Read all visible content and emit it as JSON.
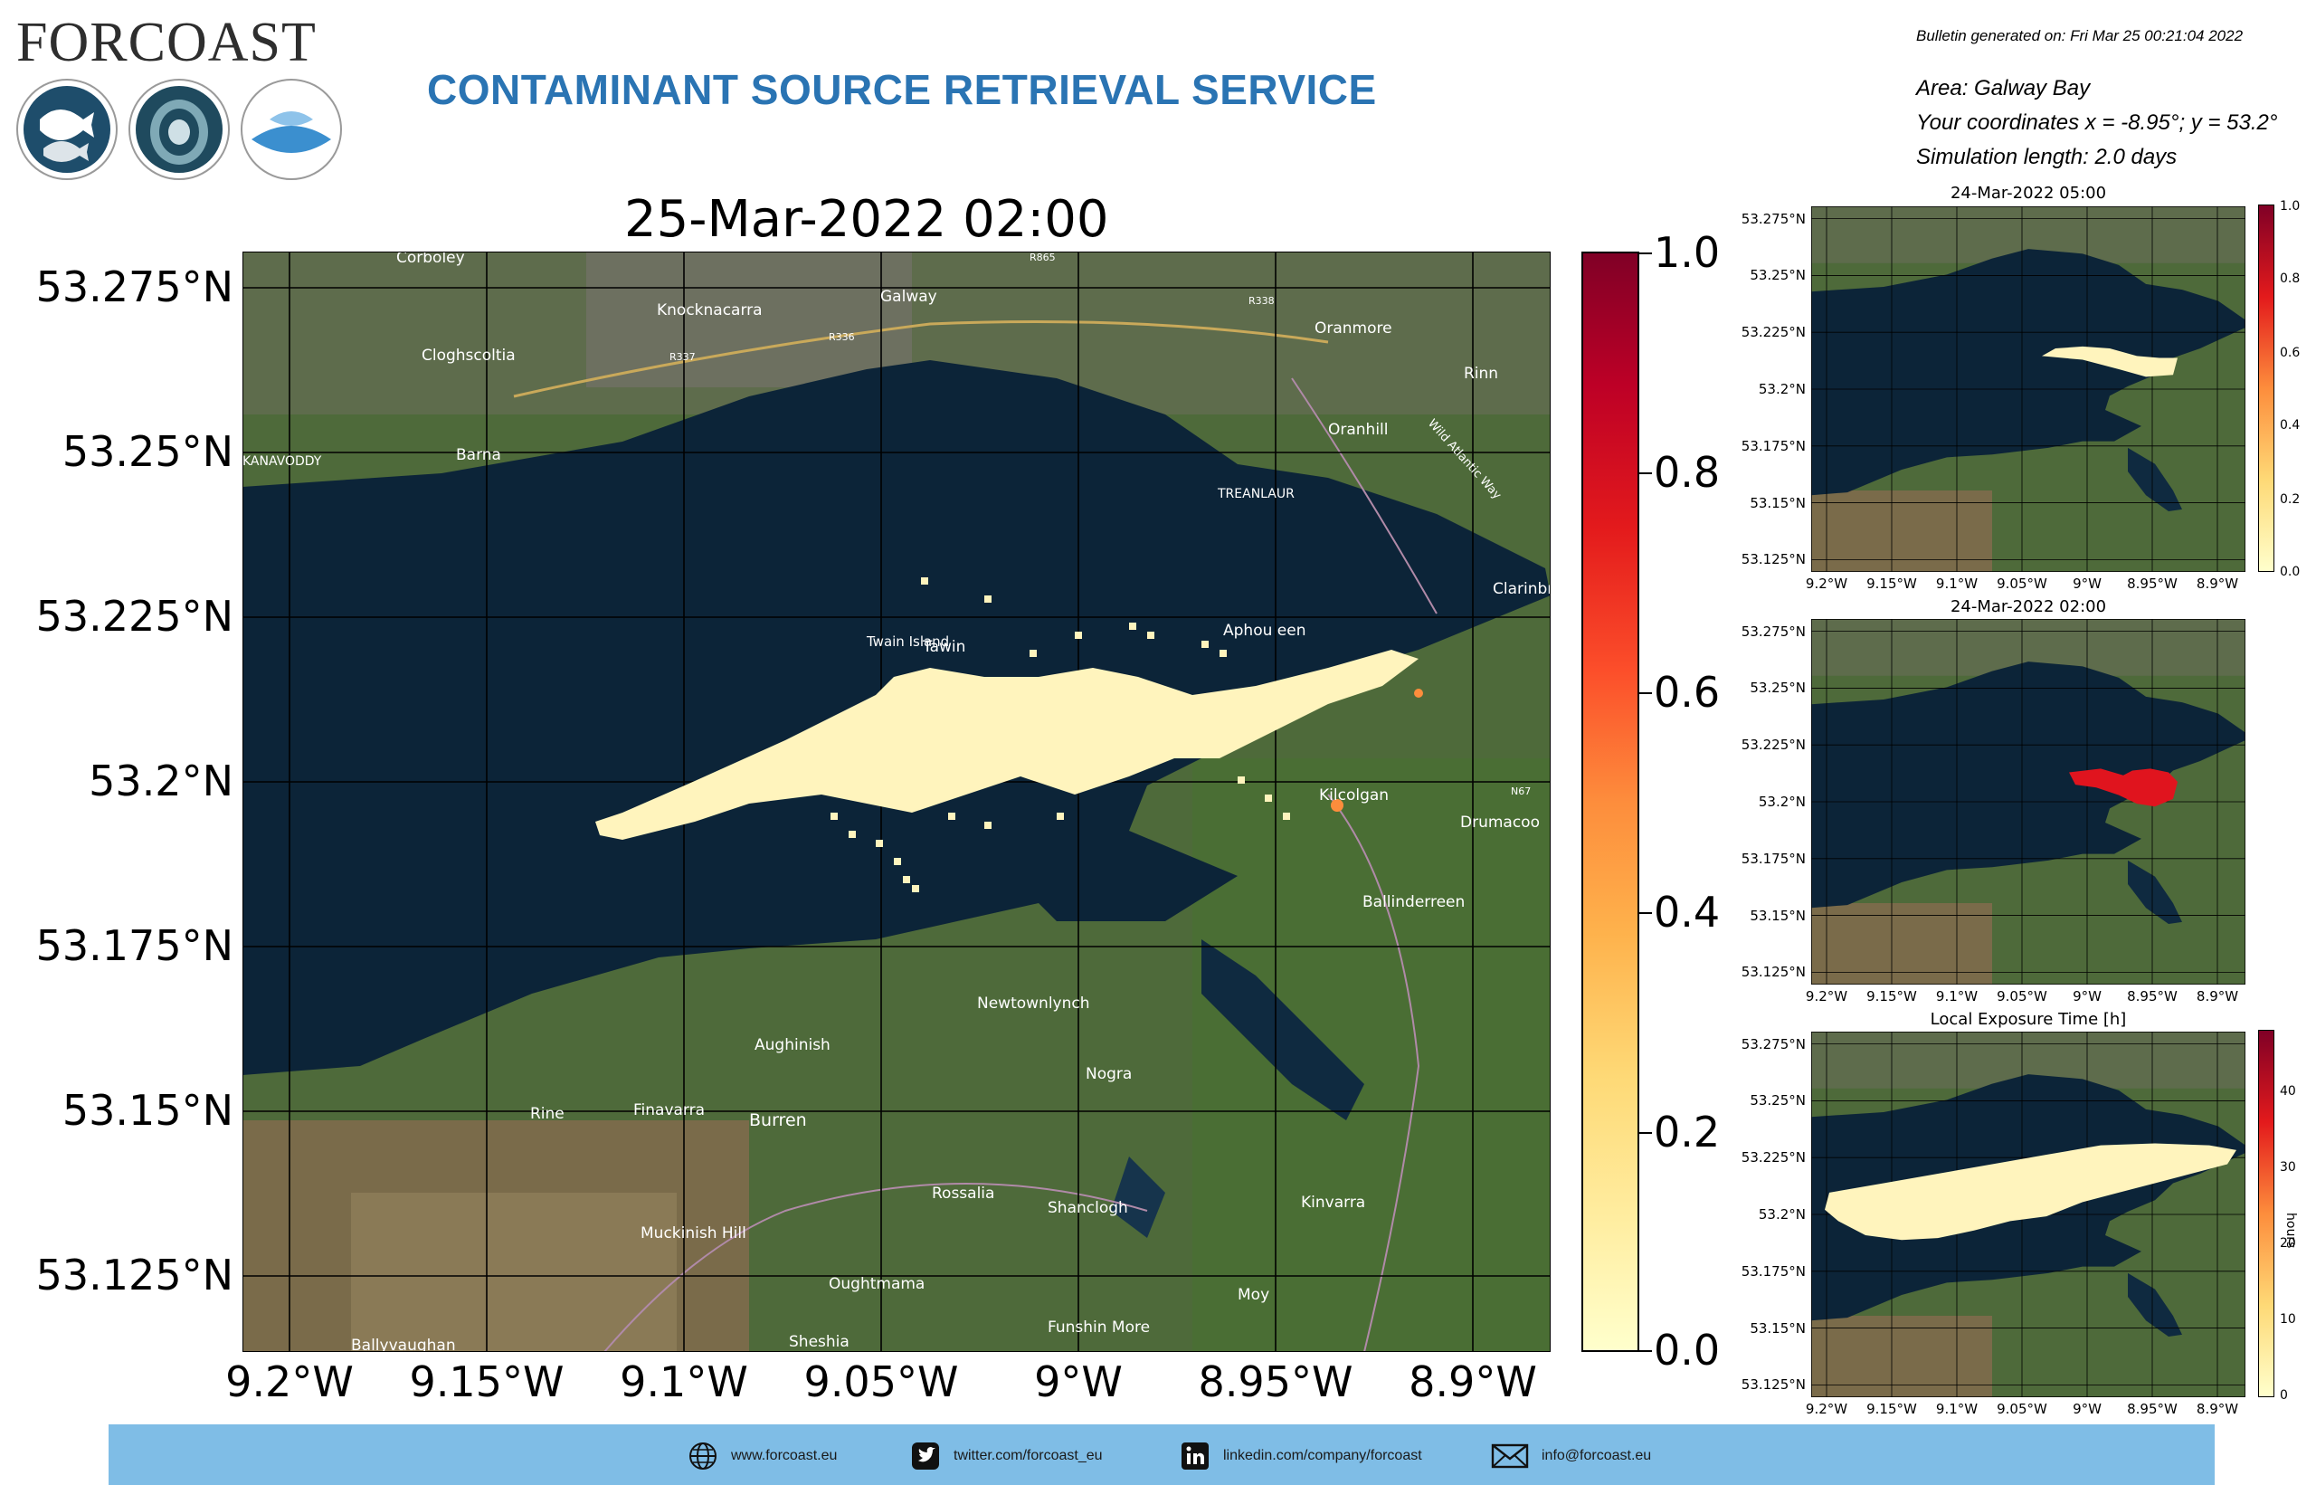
{
  "header": {
    "logo_text": "FORCOAST",
    "service_title": "CONTAMINANT SOURCE RETRIEVAL SERVICE",
    "bulletin": "Bulletin generated on: Fri Mar 25 00:21:04 2022",
    "area": "Area: Galway Bay",
    "coordinates": "Your coordinates x = -8.95°; y = 53.2°",
    "simulation": "Simulation length: 2.0 days",
    "logo_icons": [
      "fish-badge-icon",
      "oyster-badge-icon",
      "mussel-badge-icon"
    ]
  },
  "main_map": {
    "title": "25-Mar-2022 02:00",
    "lat_ticks": [
      "53.275°N",
      "53.25°N",
      "53.225°N",
      "53.2°N",
      "53.175°N",
      "53.15°N",
      "53.125°N"
    ],
    "lon_ticks": [
      "9.2°W",
      "9.15°W",
      "9.1°W",
      "9.05°W",
      "9°W",
      "8.95°W",
      "8.9°W"
    ],
    "colorbar_ticks": [
      "1.0",
      "0.8",
      "0.6",
      "0.4",
      "0.2",
      "0.0"
    ],
    "place_names": [
      "Corboley",
      "Galway",
      "Knocknacarra",
      "Cloghscoltia",
      "Oranmore",
      "Rinn",
      "Oranhill",
      "Barna",
      "KANAVODDY",
      "TREANLAUR",
      "Clarinbridge",
      "Tawin",
      "Twain Island",
      "Aphou een",
      "Kilcolgan",
      "Ballinderreen",
      "Drumacoo",
      "Newtownlynch",
      "Aughinish",
      "Nogra",
      "Burren",
      "Finavarra",
      "Rine",
      "Rossalia",
      "Shanclogh",
      "Kinvarra",
      "Muckinish Hill",
      "Oughtmama",
      "Moy",
      "Funshin More",
      "Ballyvaughan",
      "Sheshia",
      "Wild Atlantic Way",
      "N67",
      "R338",
      "R336",
      "R337",
      "R865"
    ]
  },
  "small_maps": [
    {
      "title": "24-Mar-2022 05:00",
      "colorbar_ticks": [
        "1.0",
        "0.8",
        "0.6",
        "0.4",
        "0.2",
        "0.0"
      ]
    },
    {
      "title": "24-Mar-2022 02:00",
      "colorbar_ticks": []
    },
    {
      "title": "Local Exposure Time [h]",
      "colorbar_ticks": [
        "40",
        "30",
        "20",
        "10",
        "0"
      ],
      "colorbar_unit": "hours"
    }
  ],
  "small_lat_ticks": [
    "53.275°N",
    "53.25°N",
    "53.225°N",
    "53.2°N",
    "53.175°N",
    "53.15°N",
    "53.125°N"
  ],
  "small_lon_ticks": [
    "9.2°W",
    "9.15°W",
    "9.1°W",
    "9.05°W",
    "9°W",
    "8.95°W",
    "8.9°W"
  ],
  "footer": {
    "website": "www.forcoast.eu",
    "twitter": "twitter.com/forcoast_eu",
    "linkedin": "linkedin.com/company/forcoast",
    "email": "info@forcoast.eu"
  },
  "colors": {
    "title_blue": "#2a74b3",
    "sea": "#0c2438",
    "land": "#4e6a3a",
    "plume": "#fff4bd",
    "release_point": "#e0141e",
    "footer_band": "#7fbde6"
  }
}
